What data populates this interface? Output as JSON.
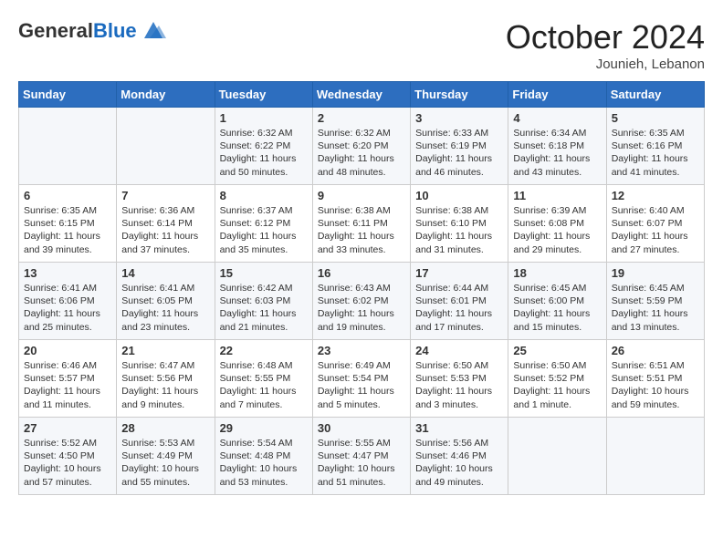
{
  "header": {
    "logo_general": "General",
    "logo_blue": "Blue",
    "month_title": "October 2024",
    "subtitle": "Jounieh, Lebanon"
  },
  "weekdays": [
    "Sunday",
    "Monday",
    "Tuesday",
    "Wednesday",
    "Thursday",
    "Friday",
    "Saturday"
  ],
  "rows": [
    [
      {
        "day": "",
        "info": ""
      },
      {
        "day": "",
        "info": ""
      },
      {
        "day": "1",
        "info": "Sunrise: 6:32 AM\nSunset: 6:22 PM\nDaylight: 11 hours and 50 minutes."
      },
      {
        "day": "2",
        "info": "Sunrise: 6:32 AM\nSunset: 6:20 PM\nDaylight: 11 hours and 48 minutes."
      },
      {
        "day": "3",
        "info": "Sunrise: 6:33 AM\nSunset: 6:19 PM\nDaylight: 11 hours and 46 minutes."
      },
      {
        "day": "4",
        "info": "Sunrise: 6:34 AM\nSunset: 6:18 PM\nDaylight: 11 hours and 43 minutes."
      },
      {
        "day": "5",
        "info": "Sunrise: 6:35 AM\nSunset: 6:16 PM\nDaylight: 11 hours and 41 minutes."
      }
    ],
    [
      {
        "day": "6",
        "info": "Sunrise: 6:35 AM\nSunset: 6:15 PM\nDaylight: 11 hours and 39 minutes."
      },
      {
        "day": "7",
        "info": "Sunrise: 6:36 AM\nSunset: 6:14 PM\nDaylight: 11 hours and 37 minutes."
      },
      {
        "day": "8",
        "info": "Sunrise: 6:37 AM\nSunset: 6:12 PM\nDaylight: 11 hours and 35 minutes."
      },
      {
        "day": "9",
        "info": "Sunrise: 6:38 AM\nSunset: 6:11 PM\nDaylight: 11 hours and 33 minutes."
      },
      {
        "day": "10",
        "info": "Sunrise: 6:38 AM\nSunset: 6:10 PM\nDaylight: 11 hours and 31 minutes."
      },
      {
        "day": "11",
        "info": "Sunrise: 6:39 AM\nSunset: 6:08 PM\nDaylight: 11 hours and 29 minutes."
      },
      {
        "day": "12",
        "info": "Sunrise: 6:40 AM\nSunset: 6:07 PM\nDaylight: 11 hours and 27 minutes."
      }
    ],
    [
      {
        "day": "13",
        "info": "Sunrise: 6:41 AM\nSunset: 6:06 PM\nDaylight: 11 hours and 25 minutes."
      },
      {
        "day": "14",
        "info": "Sunrise: 6:41 AM\nSunset: 6:05 PM\nDaylight: 11 hours and 23 minutes."
      },
      {
        "day": "15",
        "info": "Sunrise: 6:42 AM\nSunset: 6:03 PM\nDaylight: 11 hours and 21 minutes."
      },
      {
        "day": "16",
        "info": "Sunrise: 6:43 AM\nSunset: 6:02 PM\nDaylight: 11 hours and 19 minutes."
      },
      {
        "day": "17",
        "info": "Sunrise: 6:44 AM\nSunset: 6:01 PM\nDaylight: 11 hours and 17 minutes."
      },
      {
        "day": "18",
        "info": "Sunrise: 6:45 AM\nSunset: 6:00 PM\nDaylight: 11 hours and 15 minutes."
      },
      {
        "day": "19",
        "info": "Sunrise: 6:45 AM\nSunset: 5:59 PM\nDaylight: 11 hours and 13 minutes."
      }
    ],
    [
      {
        "day": "20",
        "info": "Sunrise: 6:46 AM\nSunset: 5:57 PM\nDaylight: 11 hours and 11 minutes."
      },
      {
        "day": "21",
        "info": "Sunrise: 6:47 AM\nSunset: 5:56 PM\nDaylight: 11 hours and 9 minutes."
      },
      {
        "day": "22",
        "info": "Sunrise: 6:48 AM\nSunset: 5:55 PM\nDaylight: 11 hours and 7 minutes."
      },
      {
        "day": "23",
        "info": "Sunrise: 6:49 AM\nSunset: 5:54 PM\nDaylight: 11 hours and 5 minutes."
      },
      {
        "day": "24",
        "info": "Sunrise: 6:50 AM\nSunset: 5:53 PM\nDaylight: 11 hours and 3 minutes."
      },
      {
        "day": "25",
        "info": "Sunrise: 6:50 AM\nSunset: 5:52 PM\nDaylight: 11 hours and 1 minute."
      },
      {
        "day": "26",
        "info": "Sunrise: 6:51 AM\nSunset: 5:51 PM\nDaylight: 10 hours and 59 minutes."
      }
    ],
    [
      {
        "day": "27",
        "info": "Sunrise: 5:52 AM\nSunset: 4:50 PM\nDaylight: 10 hours and 57 minutes."
      },
      {
        "day": "28",
        "info": "Sunrise: 5:53 AM\nSunset: 4:49 PM\nDaylight: 10 hours and 55 minutes."
      },
      {
        "day": "29",
        "info": "Sunrise: 5:54 AM\nSunset: 4:48 PM\nDaylight: 10 hours and 53 minutes."
      },
      {
        "day": "30",
        "info": "Sunrise: 5:55 AM\nSunset: 4:47 PM\nDaylight: 10 hours and 51 minutes."
      },
      {
        "day": "31",
        "info": "Sunrise: 5:56 AM\nSunset: 4:46 PM\nDaylight: 10 hours and 49 minutes."
      },
      {
        "day": "",
        "info": ""
      },
      {
        "day": "",
        "info": ""
      }
    ]
  ]
}
